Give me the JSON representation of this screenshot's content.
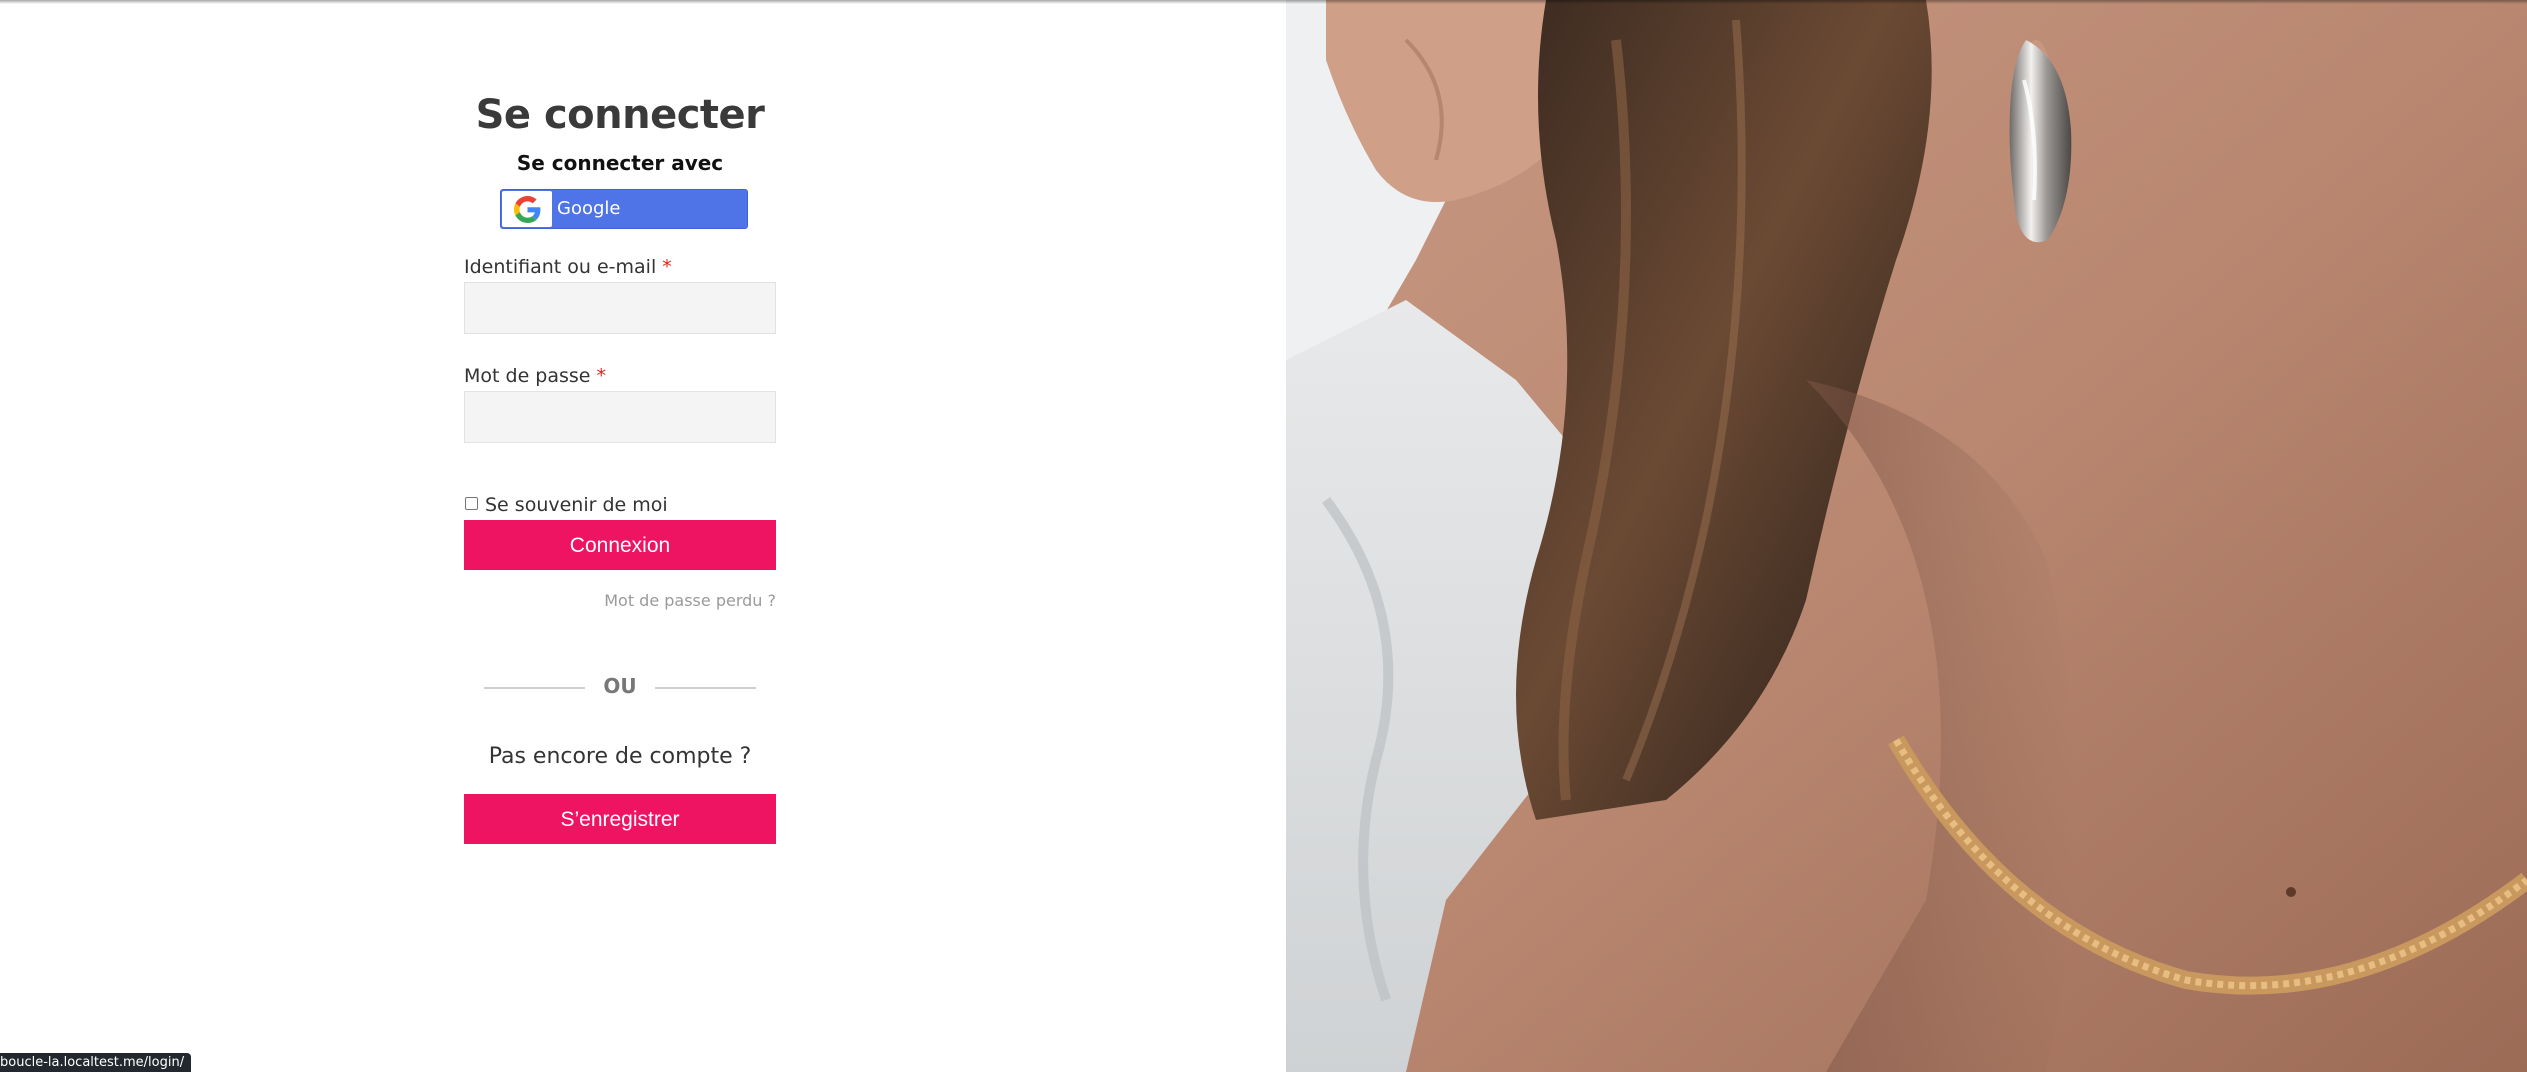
{
  "login": {
    "title": "Se connecter",
    "social_heading": "Se connecter avec",
    "google_label": "Google",
    "username_label": "Identifiant ou e-mail",
    "password_label": "Mot de passe",
    "required_marker": "*",
    "username_value": "",
    "password_value": "",
    "remember_label": "Se souvenir de moi",
    "remember_checked": false,
    "submit_label": "Connexion",
    "lost_password_label": "Mot de passe perdu ?",
    "divider_label": "OU",
    "no_account_text": "Pas encore de compte ?",
    "register_label": "S’enregistrer"
  },
  "status_bar": {
    "url": "boucle-la.localtest.me/login/"
  },
  "colors": {
    "accent": "#ef1461",
    "google_blue": "#4f74e8",
    "input_bg": "#f4f4f4"
  },
  "icons": {
    "google": "google-g-icon"
  }
}
